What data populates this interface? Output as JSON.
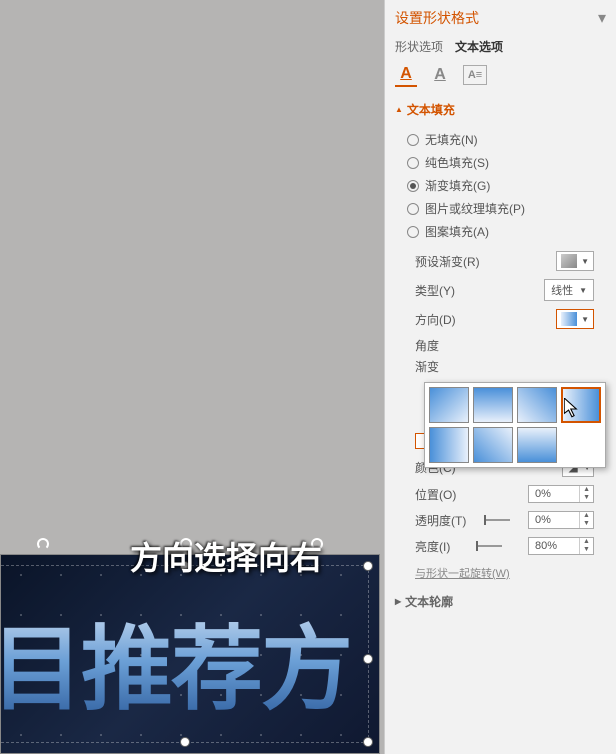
{
  "panel": {
    "title": "设置形状格式",
    "tabs": {
      "shape": "形状选项",
      "text": "文本选项"
    },
    "section": {
      "fill": "文本填充",
      "outline": "文本轮廓"
    },
    "fill_options": {
      "none": "无填充(N)",
      "solid": "纯色填充(S)",
      "gradient": "渐变填充(G)",
      "picture": "图片或纹理填充(P)",
      "pattern": "图案填充(A)"
    },
    "controls": {
      "preset": "预设渐变(R)",
      "type": "类型(Y)",
      "type_value": "线性",
      "direction": "方向(D)",
      "angle": "角度",
      "stops": "渐变",
      "color": "颜色(C)",
      "position": "位置(O)",
      "position_value": "0%",
      "transparency": "透明度(T)",
      "transparency_value": "0%",
      "brightness": "亮度(I)",
      "brightness_value": "80%",
      "rotate_with_shape": "与形状一起旋转(W)"
    }
  },
  "caption": "方向选择向右",
  "slide_text": "目推荐方"
}
